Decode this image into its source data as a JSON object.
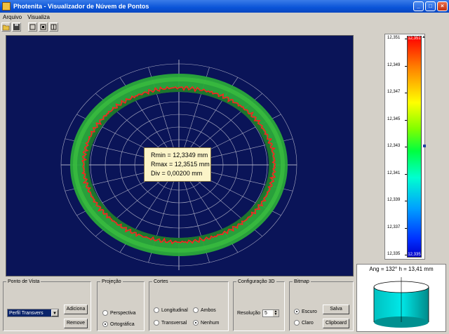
{
  "window": {
    "title": "Photenita - Visualizador de Núvem de Pontos",
    "controls": {
      "minimize": "_",
      "maximize": "□",
      "close": "×"
    }
  },
  "menu": {
    "items": [
      "Arquivo",
      "Visualiza"
    ]
  },
  "toolbar": {
    "tools": [
      "open-icon",
      "save-icon",
      "view-2d-icon",
      "view-3d-icon",
      "view-mode-icon"
    ]
  },
  "viewport": {
    "info": {
      "rmin": "Rmin = 12,3349 mm",
      "rmax": "Rmax = 12,3515 mm",
      "div": "Div  = 0,00200 mm"
    }
  },
  "colorbar": {
    "ticks": [
      "12,351",
      "12,349",
      "12,347",
      "12,345",
      "12,343",
      "12,341",
      "12,339",
      "12,337",
      "12,335"
    ],
    "top_value": "12,351",
    "bottom_value": "12,335",
    "marker_value": 12.343,
    "colors": [
      "#ff0000",
      "#ff8000",
      "#ffff00",
      "#80ff00",
      "#00ff40",
      "#00ffd0",
      "#00a0ff",
      "#0030ff",
      "#0000c8"
    ]
  },
  "preview": {
    "caption": "Ang = 132°  h = 13,41 mm"
  },
  "ponto_de_vista": {
    "legend": "Ponto de Vista",
    "selected": "Perfil Transvers",
    "add_label": "Adiciona",
    "remove_label": "Remove"
  },
  "projecao": {
    "legend": "Projeção",
    "options": [
      {
        "label": "Perspectiva",
        "checked": false
      },
      {
        "label": "Ortográfica",
        "checked": true
      }
    ]
  },
  "cortes": {
    "legend": "Cortes",
    "options": [
      {
        "label": "Longitudinal",
        "checked": false
      },
      {
        "label": "Ambos",
        "checked": false
      },
      {
        "label": "Transversal",
        "checked": false
      },
      {
        "label": "Nenhum",
        "checked": true
      }
    ]
  },
  "config3d": {
    "legend": "Configuração 3D",
    "resolution_label": "Resolução",
    "resolution_value": "5"
  },
  "bitmap": {
    "legend": "Bitmap",
    "options": [
      {
        "label": "Escuro",
        "checked": true
      },
      {
        "label": "Claro",
        "checked": false
      }
    ],
    "save_label": "Salva",
    "clipboard_label": "Clipboard"
  },
  "colors": {
    "title_bar": "#0a54d8",
    "viewport_bg": "#0a1458",
    "ring_green": "#2aa83a",
    "ring_red": "#ff2020"
  }
}
